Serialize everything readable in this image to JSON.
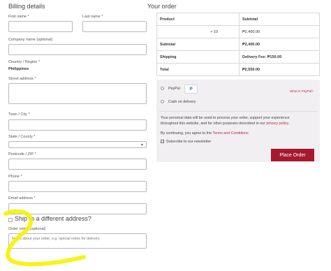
{
  "billing": {
    "title": "Billing details",
    "first_name_label": "First name",
    "last_name_label": "Last name",
    "company_label": "Company name (optional)",
    "country_label": "Country / Region",
    "country_value": "Philippines",
    "street_label": "Street address",
    "town_label": "Town / City",
    "state_label": "State / County",
    "postcode_label": "Postcode / ZIP",
    "phone_label": "Phone",
    "email_label": "Email address",
    "required_mark": "*"
  },
  "shipping": {
    "ship_different_label": "Ship to a different address?",
    "order_notes_label": "Order notes (optional)",
    "order_notes_placeholder": "Notes about your order, e.g. special notes for delivery."
  },
  "order": {
    "title": "Your order",
    "headers": {
      "product": "Product",
      "subtotal": "Subtotal"
    },
    "item": {
      "qty": "× 10",
      "subtotal": "₱2,400.00"
    },
    "subtotal_row": {
      "label": "Subtotal",
      "value": "₱2,400.00"
    },
    "shipping_row": {
      "label": "Shipping",
      "value": "Delivery Fee: ₱150.00"
    },
    "total_row": {
      "label": "Total",
      "value": "₱2,550.00"
    }
  },
  "payment": {
    "paypal_label": "PayPal",
    "paypal_badge": "P",
    "what_is_paypal": "What is PayPal?",
    "cod_label": "Cash on delivery",
    "privacy_text_1": "Your personal data will be used to process your order, support your experience",
    "privacy_text_2": "throughout this website, and for other purposes described in our",
    "privacy_link": "privacy policy.",
    "terms_text": "By continuing, you agree to the",
    "terms_link": "Terms and Conditions",
    "newsletter_label": "Subscribe to our newsletter",
    "newsletter_check": "✓",
    "place_order_label": "Place Order"
  },
  "colors": {
    "accent": "#a6192e",
    "highlight": "#f5f200"
  }
}
